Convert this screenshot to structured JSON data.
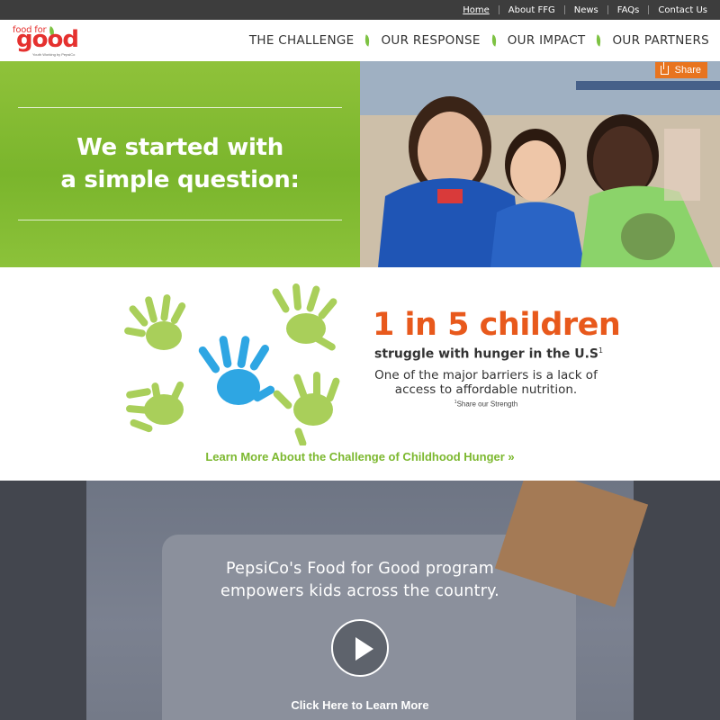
{
  "topnav": {
    "items": [
      {
        "label": "Home",
        "active": true
      },
      {
        "label": "About FFG"
      },
      {
        "label": "News"
      },
      {
        "label": "FAQs"
      },
      {
        "label": "Contact Us"
      }
    ]
  },
  "logo": {
    "line1": "food for",
    "line2": "good",
    "tagline": "Youth Working by PepsiCo"
  },
  "mainnav": {
    "items": [
      {
        "label": "THE CHALLENGE"
      },
      {
        "label": "OUR RESPONSE"
      },
      {
        "label": "OUR IMPACT"
      },
      {
        "label": "OUR PARTNERS"
      }
    ]
  },
  "hero": {
    "headline_line1": "We started with",
    "headline_line2": "a simple question:",
    "share_label": "Share"
  },
  "stats": {
    "big": "1 in 5 children",
    "sub": "struggle with hunger in the U.S",
    "sub_sup": "1",
    "desc_line1": "One of the major barriers is a lack of",
    "desc_line2": "access to affordable nutrition.",
    "footnote_sup": "1",
    "footnote": "Share our Strength",
    "learn_link": "Learn More About the Challenge of Childhood Hunger »"
  },
  "video": {
    "text_line1": "PepsiCo's Food for Good program",
    "text_line2": "empowers kids across the country.",
    "link": "Click Here to Learn More"
  },
  "colors": {
    "brand_red": "#e5312f",
    "brand_green": "#7dc242",
    "accent_orange": "#e8591c",
    "topbar": "#3d3d3d"
  }
}
